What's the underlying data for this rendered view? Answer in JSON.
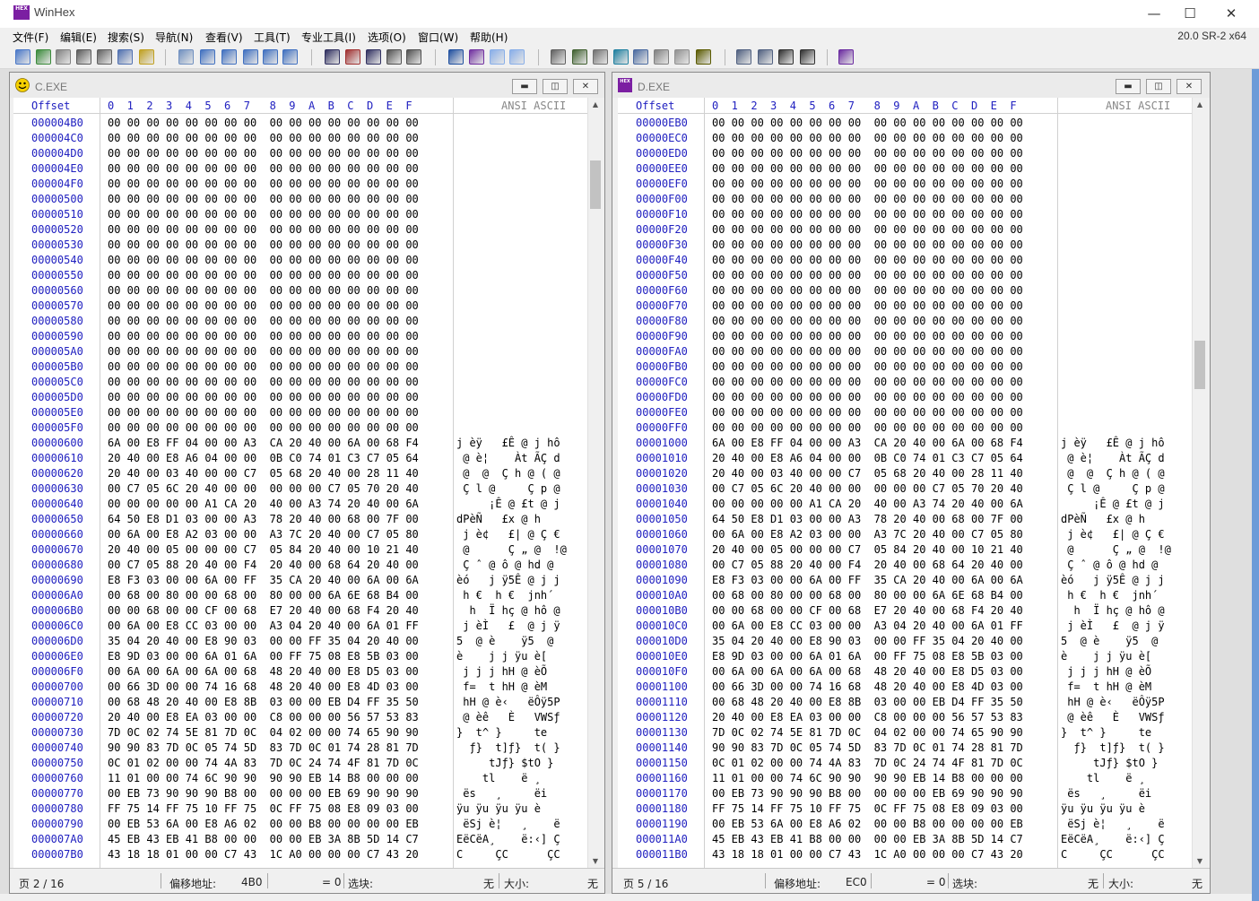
{
  "window": {
    "title": "WinHex",
    "icon_text": "HEX",
    "version": "20.0 SR-2 x64",
    "controls": {
      "minimize": "—",
      "maximize": "☐",
      "close": "✕"
    }
  },
  "menu": [
    "文件(F)",
    "编辑(E)",
    "搜索(S)",
    "导航(N)",
    "查看(V)",
    "工具(T)",
    "专业工具(I)",
    "选项(O)",
    "窗口(W)",
    "帮助(H)"
  ],
  "toolbar_icons": [
    "new-file-icon",
    "open-icon",
    "save-icon",
    "save-all-icon",
    "print-icon",
    "properties-icon",
    "export-icon",
    "undo-icon",
    "copy-icon",
    "cut-icon",
    "paste-icon",
    "clipboard-icon",
    "write-icon",
    "find-icon",
    "find-hex-icon",
    "replace-icon",
    "replace-hex-icon",
    "find-next-icon",
    "goto-offset-icon",
    "goto-icon",
    "back-icon",
    "forward-icon",
    "open-disk-icon",
    "open-ram-icon",
    "open-drive-icon",
    "calculator-icon",
    "zoom-icon",
    "hash-icon",
    "bookmark-icon",
    "settings-icon",
    "compare-icon",
    "grid-icon",
    "prev-window-icon",
    "next-window-icon",
    "help-book-icon"
  ],
  "hex_header": {
    "offset": "Offset",
    "columns": "0  1  2  3  4  5  6  7   8  9  A  B  C  D  E  F",
    "ansi": "ANSI ASCII"
  },
  "panes": [
    {
      "name": "C.EXE",
      "page": "页 2 / 16",
      "offset_label": "偏移地址:",
      "offset_value": "4B0",
      "equals": "= 0",
      "selection_label": "选块:",
      "selection_value": "无",
      "size_label": "大小:",
      "size_value": "无",
      "scroll_fraction": 0.07,
      "rows": [
        {
          "o": "000004B0",
          "h": "00 00 00 00 00 00 00 00  00 00 00 00 00 00 00 00",
          "a": ""
        },
        {
          "o": "000004C0",
          "h": "00 00 00 00 00 00 00 00  00 00 00 00 00 00 00 00",
          "a": ""
        },
        {
          "o": "000004D0",
          "h": "00 00 00 00 00 00 00 00  00 00 00 00 00 00 00 00",
          "a": ""
        },
        {
          "o": "000004E0",
          "h": "00 00 00 00 00 00 00 00  00 00 00 00 00 00 00 00",
          "a": ""
        },
        {
          "o": "000004F0",
          "h": "00 00 00 00 00 00 00 00  00 00 00 00 00 00 00 00",
          "a": ""
        },
        {
          "o": "00000500",
          "h": "00 00 00 00 00 00 00 00  00 00 00 00 00 00 00 00",
          "a": ""
        },
        {
          "o": "00000510",
          "h": "00 00 00 00 00 00 00 00  00 00 00 00 00 00 00 00",
          "a": ""
        },
        {
          "o": "00000520",
          "h": "00 00 00 00 00 00 00 00  00 00 00 00 00 00 00 00",
          "a": ""
        },
        {
          "o": "00000530",
          "h": "00 00 00 00 00 00 00 00  00 00 00 00 00 00 00 00",
          "a": ""
        },
        {
          "o": "00000540",
          "h": "00 00 00 00 00 00 00 00  00 00 00 00 00 00 00 00",
          "a": ""
        },
        {
          "o": "00000550",
          "h": "00 00 00 00 00 00 00 00  00 00 00 00 00 00 00 00",
          "a": ""
        },
        {
          "o": "00000560",
          "h": "00 00 00 00 00 00 00 00  00 00 00 00 00 00 00 00",
          "a": ""
        },
        {
          "o": "00000570",
          "h": "00 00 00 00 00 00 00 00  00 00 00 00 00 00 00 00",
          "a": ""
        },
        {
          "o": "00000580",
          "h": "00 00 00 00 00 00 00 00  00 00 00 00 00 00 00 00",
          "a": ""
        },
        {
          "o": "00000590",
          "h": "00 00 00 00 00 00 00 00  00 00 00 00 00 00 00 00",
          "a": ""
        },
        {
          "o": "000005A0",
          "h": "00 00 00 00 00 00 00 00  00 00 00 00 00 00 00 00",
          "a": ""
        },
        {
          "o": "000005B0",
          "h": "00 00 00 00 00 00 00 00  00 00 00 00 00 00 00 00",
          "a": ""
        },
        {
          "o": "000005C0",
          "h": "00 00 00 00 00 00 00 00  00 00 00 00 00 00 00 00",
          "a": ""
        },
        {
          "o": "000005D0",
          "h": "00 00 00 00 00 00 00 00  00 00 00 00 00 00 00 00",
          "a": ""
        },
        {
          "o": "000005E0",
          "h": "00 00 00 00 00 00 00 00  00 00 00 00 00 00 00 00",
          "a": ""
        },
        {
          "o": "000005F0",
          "h": "00 00 00 00 00 00 00 00  00 00 00 00 00 00 00 00",
          "a": ""
        },
        {
          "o": "00000600",
          "h": "6A 00 E8 FF 04 00 00 A3  CA 20 40 00 6A 00 68 F4",
          "a": "j èÿ   £Ê @ j hô"
        },
        {
          "o": "00000610",
          "h": "20 40 00 E8 A6 04 00 00  0B C0 74 01 C3 C7 05 64",
          "a": " @ è¦    Àt ÃÇ d"
        },
        {
          "o": "00000620",
          "h": "20 40 00 03 40 00 00 C7  05 68 20 40 00 28 11 40",
          "a": " @  @  Ç h @ ( @"
        },
        {
          "o": "00000630",
          "h": "00 C7 05 6C 20 40 00 00  00 00 00 C7 05 70 20 40",
          "a": " Ç l @     Ç p @"
        },
        {
          "o": "00000640",
          "h": "00 00 00 00 00 A1 CA 20  40 00 A3 74 20 40 00 6A",
          "a": "     ¡Ê @ £t @ j"
        },
        {
          "o": "00000650",
          "h": "64 50 E8 D1 03 00 00 A3  78 20 40 00 68 00 7F 00",
          "a": "dPèÑ   £x @ h  "
        },
        {
          "o": "00000660",
          "h": "00 6A 00 E8 A2 03 00 00  A3 7C 20 40 00 C7 05 80",
          "a": " j è¢   £| @ Ç €"
        },
        {
          "o": "00000670",
          "h": "20 40 00 05 00 00 00 C7  05 84 20 40 00 10 21 40",
          "a": " @      Ç „ @  !@"
        },
        {
          "o": "00000680",
          "h": "00 C7 05 88 20 40 00 F4  20 40 00 68 64 20 40 00",
          "a": " Ç ˆ @ ô @ hd @ "
        },
        {
          "o": "00000690",
          "h": "E8 F3 03 00 00 6A 00 FF  35 CA 20 40 00 6A 00 6A",
          "a": "èó   j ÿ5Ê @ j j"
        },
        {
          "o": "000006A0",
          "h": "00 68 00 80 00 00 68 00  80 00 00 6A 6E 68 B4 00",
          "a": " h €  h €  jnh´ "
        },
        {
          "o": "000006B0",
          "h": "00 00 68 00 00 CF 00 68  E7 20 40 00 68 F4 20 40",
          "a": "  h  Ï hç @ hô @"
        },
        {
          "o": "000006C0",
          "h": "00 6A 00 E8 CC 03 00 00  A3 04 20 40 00 6A 01 FF",
          "a": " j èÌ   £  @ j ÿ"
        },
        {
          "o": "000006D0",
          "h": "35 04 20 40 00 E8 90 03  00 00 FF 35 04 20 40 00",
          "a": "5  @ è    ÿ5  @ "
        },
        {
          "o": "000006E0",
          "h": "E8 9D 03 00 00 6A 01 6A  00 FF 75 08 E8 5B 03 00",
          "a": "è    j j ÿu è[  "
        },
        {
          "o": "000006F0",
          "h": "00 6A 00 6A 00 6A 00 68  48 20 40 00 E8 D5 03 00",
          "a": " j j j hH @ èÕ  "
        },
        {
          "o": "00000700",
          "h": "00 66 3D 00 00 74 16 68  48 20 40 00 E8 4D 03 00",
          "a": " f=  t hH @ èM  "
        },
        {
          "o": "00000710",
          "h": "00 68 48 20 40 00 E8 8B  03 00 00 EB D4 FF 35 50",
          "a": " hH @ è‹   ëÔÿ5P"
        },
        {
          "o": "00000720",
          "h": "20 40 00 E8 EA 03 00 00  C8 00 00 00 56 57 53 83",
          "a": " @ èê   È   VWSƒ"
        },
        {
          "o": "00000730",
          "h": "7D 0C 02 74 5E 81 7D 0C  04 02 00 00 74 65 90 90",
          "a": "}  t^ }     te  "
        },
        {
          "o": "00000740",
          "h": "90 90 83 7D 0C 05 74 5D  83 7D 0C 01 74 28 81 7D",
          "a": "  ƒ}  t]ƒ}  t( }"
        },
        {
          "o": "00000750",
          "h": "0C 01 02 00 00 74 4A 83  7D 0C 24 74 4F 81 7D 0C",
          "a": "     tJƒ} $tO } "
        },
        {
          "o": "00000760",
          "h": "11 01 00 00 74 6C 90 90  90 90 EB 14 B8 00 00 00",
          "a": "    tl    ë ¸   "
        },
        {
          "o": "00000770",
          "h": "00 EB 73 90 90 90 B8 00  00 00 00 EB 69 90 90 90",
          "a": " ës   ¸     ëi   "
        },
        {
          "o": "00000780",
          "h": "FF 75 14 FF 75 10 FF 75  0C FF 75 08 E8 09 03 00",
          "a": "ÿu ÿu ÿu ÿu è   "
        },
        {
          "o": "00000790",
          "h": "00 EB 53 6A 00 E8 A6 02  00 00 B8 00 00 00 00 EB",
          "a": " ëSj è¦   ¸    ë"
        },
        {
          "o": "000007A0",
          "h": "45 EB 43 EB 41 B8 00 00  00 00 EB 3A 8B 5D 14 C7",
          "a": "EëCëA¸    ë:‹] Ç"
        },
        {
          "o": "000007B0",
          "h": "43 18 18 01 00 00 C7 43  1C A0 00 00 00 C7 43 20",
          "a": "C     ÇC      ÇC "
        }
      ]
    },
    {
      "name": "D.EXE",
      "page": "页 5 / 16",
      "offset_label": "偏移地址:",
      "offset_value": "EC0",
      "equals": "= 0",
      "selection_label": "选块:",
      "selection_value": "无",
      "size_label": "大小:",
      "size_value": "无",
      "scroll_fraction": 0.33,
      "rows": [
        {
          "o": "00000EB0",
          "h": "00 00 00 00 00 00 00 00  00 00 00 00 00 00 00 00",
          "a": ""
        },
        {
          "o": "00000EC0",
          "h": "00 00 00 00 00 00 00 00  00 00 00 00 00 00 00 00",
          "a": ""
        },
        {
          "o": "00000ED0",
          "h": "00 00 00 00 00 00 00 00  00 00 00 00 00 00 00 00",
          "a": ""
        },
        {
          "o": "00000EE0",
          "h": "00 00 00 00 00 00 00 00  00 00 00 00 00 00 00 00",
          "a": ""
        },
        {
          "o": "00000EF0",
          "h": "00 00 00 00 00 00 00 00  00 00 00 00 00 00 00 00",
          "a": ""
        },
        {
          "o": "00000F00",
          "h": "00 00 00 00 00 00 00 00  00 00 00 00 00 00 00 00",
          "a": ""
        },
        {
          "o": "00000F10",
          "h": "00 00 00 00 00 00 00 00  00 00 00 00 00 00 00 00",
          "a": ""
        },
        {
          "o": "00000F20",
          "h": "00 00 00 00 00 00 00 00  00 00 00 00 00 00 00 00",
          "a": ""
        },
        {
          "o": "00000F30",
          "h": "00 00 00 00 00 00 00 00  00 00 00 00 00 00 00 00",
          "a": ""
        },
        {
          "o": "00000F40",
          "h": "00 00 00 00 00 00 00 00  00 00 00 00 00 00 00 00",
          "a": ""
        },
        {
          "o": "00000F50",
          "h": "00 00 00 00 00 00 00 00  00 00 00 00 00 00 00 00",
          "a": ""
        },
        {
          "o": "00000F60",
          "h": "00 00 00 00 00 00 00 00  00 00 00 00 00 00 00 00",
          "a": ""
        },
        {
          "o": "00000F70",
          "h": "00 00 00 00 00 00 00 00  00 00 00 00 00 00 00 00",
          "a": ""
        },
        {
          "o": "00000F80",
          "h": "00 00 00 00 00 00 00 00  00 00 00 00 00 00 00 00",
          "a": ""
        },
        {
          "o": "00000F90",
          "h": "00 00 00 00 00 00 00 00  00 00 00 00 00 00 00 00",
          "a": ""
        },
        {
          "o": "00000FA0",
          "h": "00 00 00 00 00 00 00 00  00 00 00 00 00 00 00 00",
          "a": ""
        },
        {
          "o": "00000FB0",
          "h": "00 00 00 00 00 00 00 00  00 00 00 00 00 00 00 00",
          "a": ""
        },
        {
          "o": "00000FC0",
          "h": "00 00 00 00 00 00 00 00  00 00 00 00 00 00 00 00",
          "a": ""
        },
        {
          "o": "00000FD0",
          "h": "00 00 00 00 00 00 00 00  00 00 00 00 00 00 00 00",
          "a": ""
        },
        {
          "o": "00000FE0",
          "h": "00 00 00 00 00 00 00 00  00 00 00 00 00 00 00 00",
          "a": ""
        },
        {
          "o": "00000FF0",
          "h": "00 00 00 00 00 00 00 00  00 00 00 00 00 00 00 00",
          "a": ""
        },
        {
          "o": "00001000",
          "h": "6A 00 E8 FF 04 00 00 A3  CA 20 40 00 6A 00 68 F4",
          "a": "j èÿ   £Ê @ j hô"
        },
        {
          "o": "00001010",
          "h": "20 40 00 E8 A6 04 00 00  0B C0 74 01 C3 C7 05 64",
          "a": " @ è¦    Àt ÃÇ d"
        },
        {
          "o": "00001020",
          "h": "20 40 00 03 40 00 00 C7  05 68 20 40 00 28 11 40",
          "a": " @  @  Ç h @ ( @"
        },
        {
          "o": "00001030",
          "h": "00 C7 05 6C 20 40 00 00  00 00 00 C7 05 70 20 40",
          "a": " Ç l @     Ç p @"
        },
        {
          "o": "00001040",
          "h": "00 00 00 00 00 A1 CA 20  40 00 A3 74 20 40 00 6A",
          "a": "     ¡Ê @ £t @ j"
        },
        {
          "o": "00001050",
          "h": "64 50 E8 D1 03 00 00 A3  78 20 40 00 68 00 7F 00",
          "a": "dPèÑ   £x @ h  "
        },
        {
          "o": "00001060",
          "h": "00 6A 00 E8 A2 03 00 00  A3 7C 20 40 00 C7 05 80",
          "a": " j è¢   £| @ Ç €"
        },
        {
          "o": "00001070",
          "h": "20 40 00 05 00 00 00 C7  05 84 20 40 00 10 21 40",
          "a": " @      Ç „ @  !@"
        },
        {
          "o": "00001080",
          "h": "00 C7 05 88 20 40 00 F4  20 40 00 68 64 20 40 00",
          "a": " Ç ˆ @ ô @ hd @ "
        },
        {
          "o": "00001090",
          "h": "E8 F3 03 00 00 6A 00 FF  35 CA 20 40 00 6A 00 6A",
          "a": "èó   j ÿ5Ê @ j j"
        },
        {
          "o": "000010A0",
          "h": "00 68 00 80 00 00 68 00  80 00 00 6A 6E 68 B4 00",
          "a": " h €  h €  jnh´ "
        },
        {
          "o": "000010B0",
          "h": "00 00 68 00 00 CF 00 68  E7 20 40 00 68 F4 20 40",
          "a": "  h  Ï hç @ hô @"
        },
        {
          "o": "000010C0",
          "h": "00 6A 00 E8 CC 03 00 00  A3 04 20 40 00 6A 01 FF",
          "a": " j èÌ   £  @ j ÿ"
        },
        {
          "o": "000010D0",
          "h": "35 04 20 40 00 E8 90 03  00 00 FF 35 04 20 40 00",
          "a": "5  @ è    ÿ5  @ "
        },
        {
          "o": "000010E0",
          "h": "E8 9D 03 00 00 6A 01 6A  00 FF 75 08 E8 5B 03 00",
          "a": "è    j j ÿu è[  "
        },
        {
          "o": "000010F0",
          "h": "00 6A 00 6A 00 6A 00 68  48 20 40 00 E8 D5 03 00",
          "a": " j j j hH @ èÕ  "
        },
        {
          "o": "00001100",
          "h": "00 66 3D 00 00 74 16 68  48 20 40 00 E8 4D 03 00",
          "a": " f=  t hH @ èM  "
        },
        {
          "o": "00001110",
          "h": "00 68 48 20 40 00 E8 8B  03 00 00 EB D4 FF 35 50",
          "a": " hH @ è‹   ëÔÿ5P"
        },
        {
          "o": "00001120",
          "h": "20 40 00 E8 EA 03 00 00  C8 00 00 00 56 57 53 83",
          "a": " @ èê   È   VWSƒ"
        },
        {
          "o": "00001130",
          "h": "7D 0C 02 74 5E 81 7D 0C  04 02 00 00 74 65 90 90",
          "a": "}  t^ }     te  "
        },
        {
          "o": "00001140",
          "h": "90 90 83 7D 0C 05 74 5D  83 7D 0C 01 74 28 81 7D",
          "a": "  ƒ}  t]ƒ}  t( }"
        },
        {
          "o": "00001150",
          "h": "0C 01 02 00 00 74 4A 83  7D 0C 24 74 4F 81 7D 0C",
          "a": "     tJƒ} $tO } "
        },
        {
          "o": "00001160",
          "h": "11 01 00 00 74 6C 90 90  90 90 EB 14 B8 00 00 00",
          "a": "    tl    ë ¸   "
        },
        {
          "o": "00001170",
          "h": "00 EB 73 90 90 90 B8 00  00 00 00 EB 69 90 90 90",
          "a": " ës   ¸     ëi   "
        },
        {
          "o": "00001180",
          "h": "FF 75 14 FF 75 10 FF 75  0C FF 75 08 E8 09 03 00",
          "a": "ÿu ÿu ÿu ÿu è   "
        },
        {
          "o": "00001190",
          "h": "00 EB 53 6A 00 E8 A6 02  00 00 B8 00 00 00 00 EB",
          "a": " ëSj è¦   ¸    ë"
        },
        {
          "o": "000011A0",
          "h": "45 EB 43 EB 41 B8 00 00  00 00 EB 3A 8B 5D 14 C7",
          "a": "EëCëA¸    ë:‹] Ç"
        },
        {
          "o": "000011B0",
          "h": "43 18 18 01 00 00 C7 43  1C A0 00 00 00 C7 43 20",
          "a": "C     ÇC      ÇC "
        }
      ]
    }
  ],
  "colors": {
    "offset_blue": "#2020c0",
    "accent_purple": "#7b1fa2"
  }
}
